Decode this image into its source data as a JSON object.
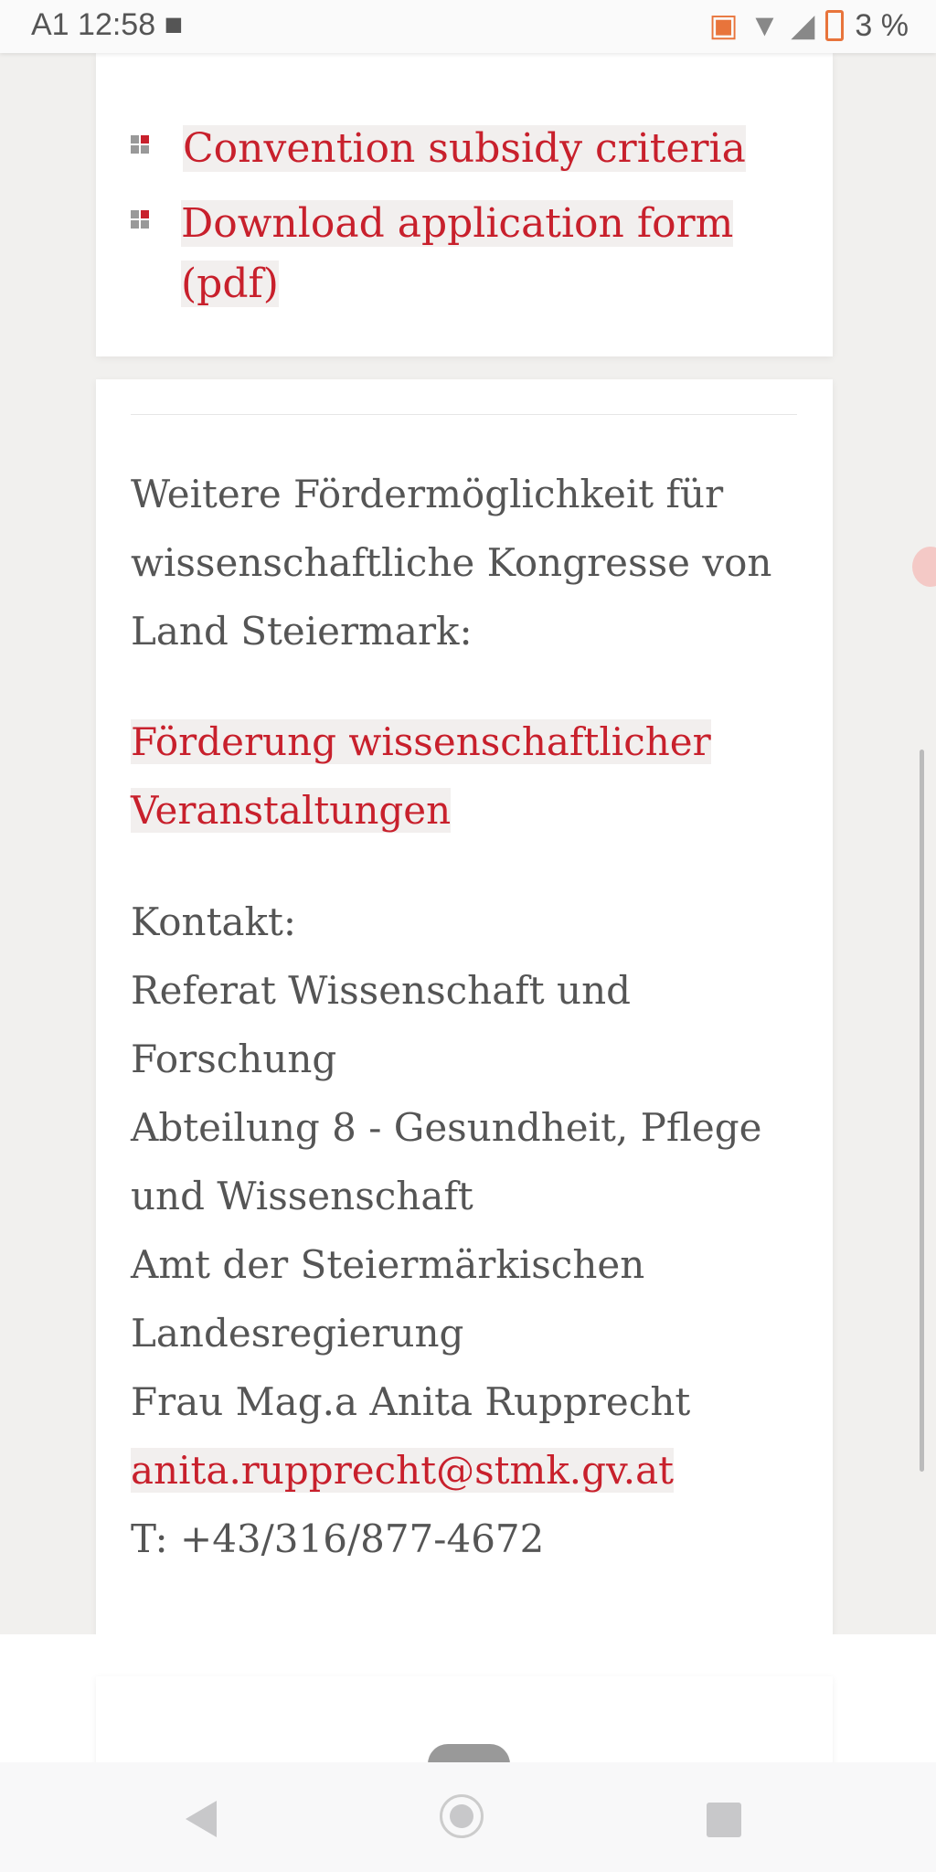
{
  "status_bar": {
    "carrier": "A1",
    "time": "12:58",
    "battery": "3 %",
    "icons": [
      "video-camera-icon",
      "cast-icon",
      "wifi-icon",
      "signal-icon",
      "battery-icon"
    ]
  },
  "links": [
    {
      "label": "Convention subsidy criteria"
    },
    {
      "label": "Download application form (pdf)"
    }
  ],
  "info": {
    "intro": "Weitere Fördermöglichkeit für wissenschaftliche Kongresse von Land Steiermark:",
    "link": "Förderung wissenschaftlicher Veranstaltungen"
  },
  "contact": {
    "heading": "Kontakt:",
    "lines": [
      "Referat Wissenschaft und Forschung",
      "Abteilung 8 - Gesundheit, Pflege und Wissenschaft",
      "Amt der Steiermärkischen Landesregierung",
      "Frau Mag.a Anita Rupprecht"
    ],
    "email": "anita.rupprecht@stmk.gv.at",
    "phone": "T: +43/316/877-4672"
  },
  "colors": {
    "accent": "#c8202c",
    "text": "#555555"
  }
}
